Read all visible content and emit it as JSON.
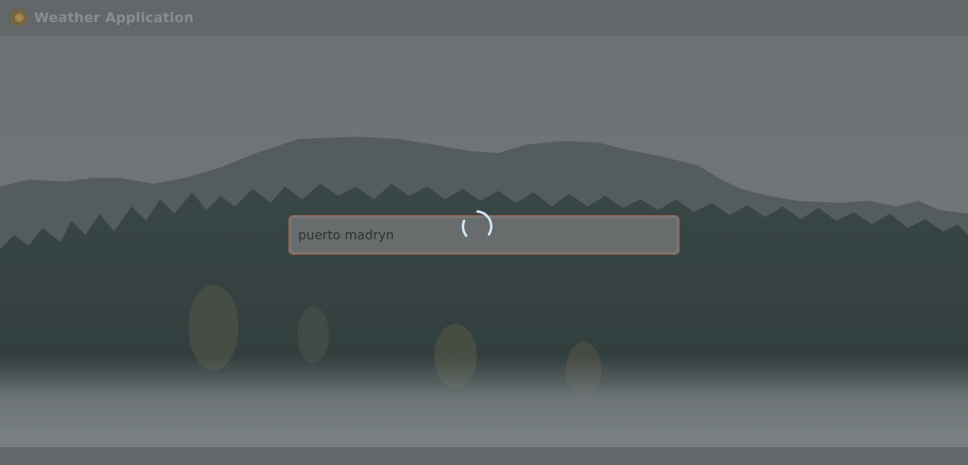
{
  "app": {
    "title": "Weather Application",
    "logo_icon": "sun-icon"
  },
  "search": {
    "value": "puerto madryn",
    "placeholder": ""
  },
  "status": {
    "loading_icon": "loading-spinner-icon"
  },
  "colors": {
    "overlay": "#6f7577",
    "input_border": "#8a6354",
    "spinner": "#cfe6f5",
    "logo": "#8f7a4a"
  }
}
